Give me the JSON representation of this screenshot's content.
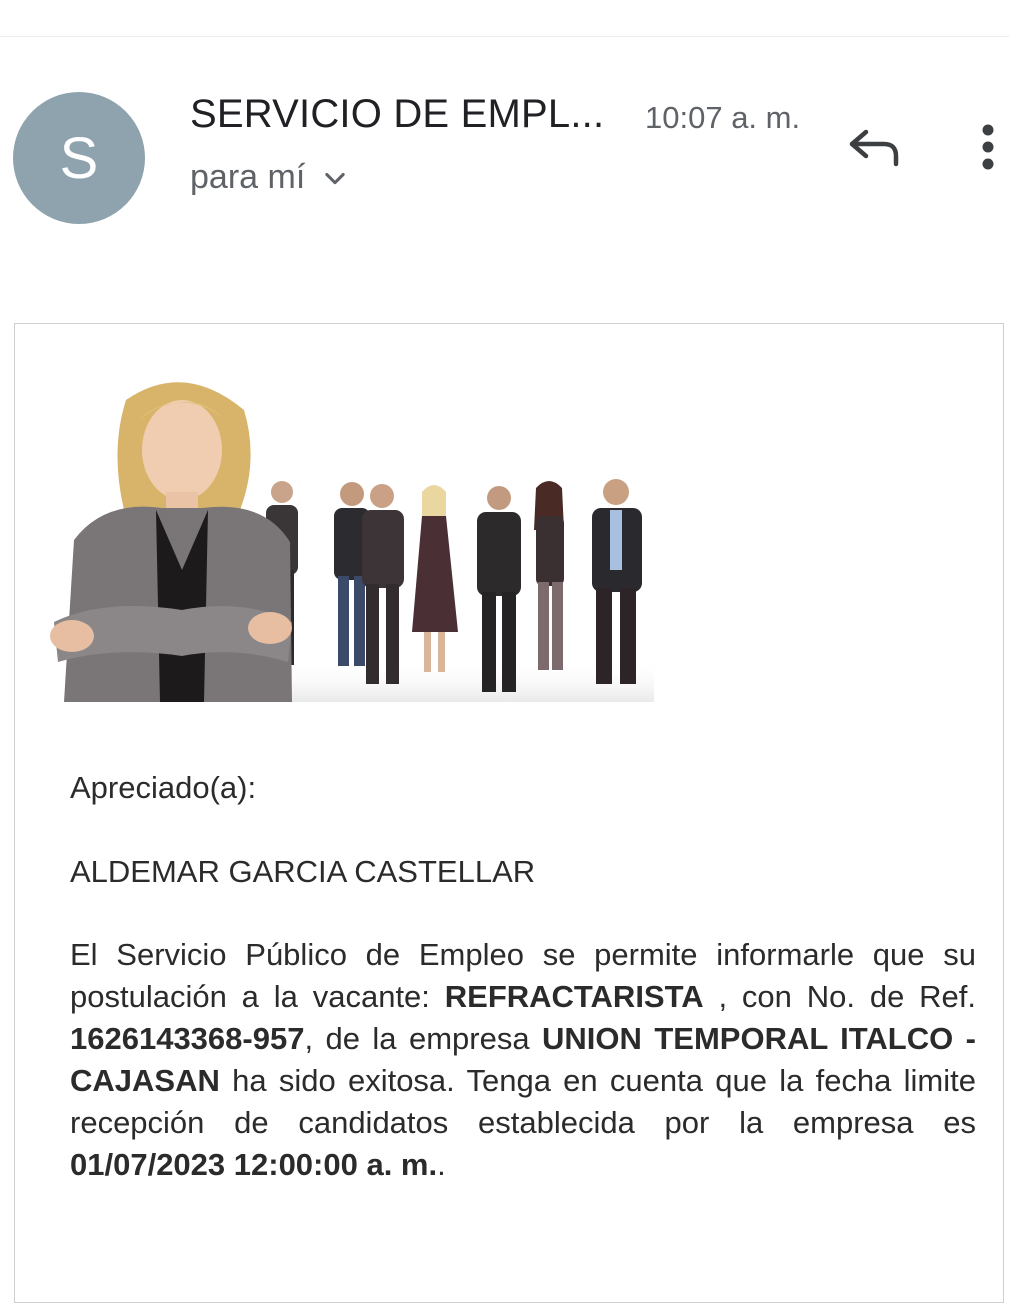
{
  "header": {
    "avatar_letter": "S",
    "sender": "SERVICIO DE EMPL...",
    "time": "10:07 a. m.",
    "recipient": "para mí"
  },
  "icons": {
    "chevron": "chevron-down-icon",
    "reply": "reply-icon",
    "more": "more-vert-icon"
  },
  "colors": {
    "avatar_bg": "#8fa3ae",
    "text": "#202124",
    "muted": "#5f6368"
  },
  "message": {
    "greeting": "Apreciado(a):",
    "candidate_name": "ALDEMAR GARCIA CASTELLAR",
    "p1": "El Servicio Público de Empleo se permite informarle que su postulación a la vacante: ",
    "vacancy": "REFRACTARISTA",
    "p2": " , con No. de Ref. ",
    "reference": "1626143368-957",
    "p3": ", de la empresa ",
    "company": "UNION TEMPORAL ITALCO - CAJASAN",
    "p4": " ha sido exitosa. Tenga en cuenta que la fecha limite recepción de candidatos establecida por la empresa es ",
    "deadline": "01/07/2023 12:00:00 a. m.",
    "p5": "."
  }
}
